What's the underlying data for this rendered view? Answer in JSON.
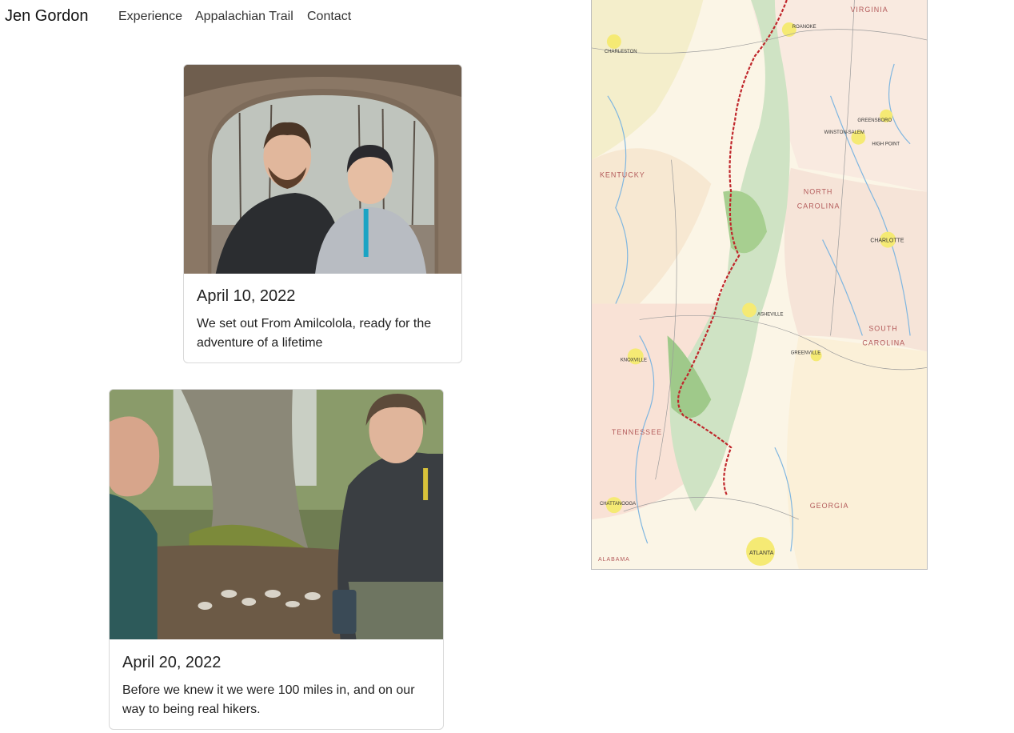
{
  "nav": {
    "brand": "Jen Gordon",
    "links": [
      "Experience",
      "Appalachian Trail",
      "Contact"
    ]
  },
  "cards": [
    {
      "date": "April 10, 2022",
      "text": "We set out From Amilcolola, ready for the adventure of a lifetime"
    },
    {
      "date": "April 20, 2022",
      "text": "Before we knew it we were 100 miles in, and on our way to being real hikers."
    }
  ],
  "map": {
    "state_labels": [
      "VIRGINIA",
      "KENTUCKY",
      "NORTH",
      "CAROLINA",
      "TENNESSEE",
      "SOUTH",
      "CAROLINA",
      "GEORGIA",
      "ALABAMA"
    ],
    "city_labels": [
      "CHARLESTON",
      "ROANOKE",
      "GREENSBORO",
      "WINSTON-SALEM",
      "HIGH POINT",
      "CHARLOTTE",
      "ASHEVILLE",
      "GREENVILLE",
      "KNOXVILLE",
      "CHATTANOOGA",
      "ATLANTA"
    ],
    "colors": {
      "trail": "#c0262b",
      "park": "#cfe3c4",
      "water": "#7fb6e0",
      "urban": "#f5ea74",
      "background": "#fbf5e6",
      "tennessee": "#f9e2d6"
    }
  }
}
